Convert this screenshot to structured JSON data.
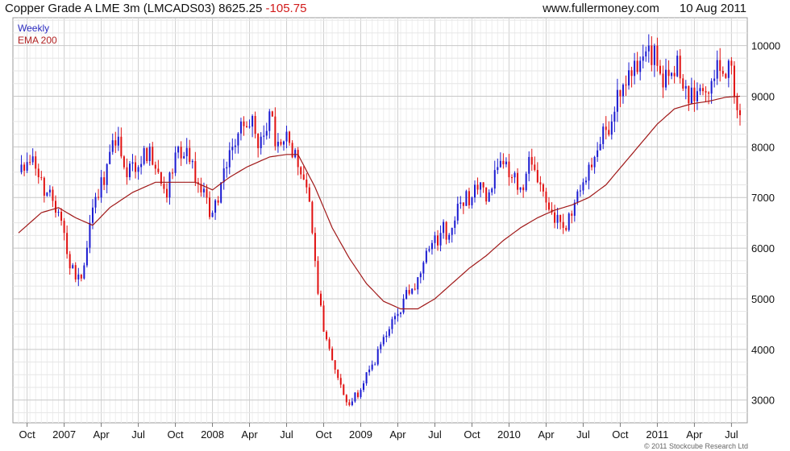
{
  "header": {
    "instrument": "Copper Grade A LME 3m (LMCADS03)",
    "last_price": "8625.25",
    "change": "-105.75",
    "website": "www.fullermoney.com",
    "date": "10 Aug 2011"
  },
  "copyright": "© 2011 Stockcube Research Ltd",
  "chart_data": {
    "type": "candlestick",
    "xlabel": "",
    "ylabel": "",
    "ylim": [
      2550,
      10550
    ],
    "grid": true,
    "legend_placement": "top-left",
    "y_ticks": [
      3000,
      4000,
      5000,
      6000,
      7000,
      8000,
      9000,
      10000
    ],
    "x_ticks": [
      "Oct",
      "2007",
      "Apr",
      "Jul",
      "Oct",
      "2008",
      "Apr",
      "Jul",
      "Oct",
      "2009",
      "Apr",
      "Jul",
      "Oct",
      "2010",
      "Apr",
      "Jul",
      "Oct",
      "2011",
      "Apr",
      "Jul"
    ],
    "x_tick_index": [
      3,
      16,
      29,
      42,
      55,
      68,
      81,
      94,
      107,
      120,
      133,
      146,
      159,
      172,
      185,
      198,
      211,
      224,
      237,
      250
    ],
    "colors": {
      "up": "#1a1ad0",
      "down": "#e01010",
      "ema": "#a01818"
    },
    "series": [
      {
        "name": "Weekly",
        "kind": "weekly_candles",
        "close_anchors": [
          [
            0,
            7500
          ],
          [
            3,
            7700
          ],
          [
            7,
            7400
          ],
          [
            10,
            7100
          ],
          [
            13,
            6700
          ],
          [
            16,
            6300
          ],
          [
            18,
            5600
          ],
          [
            22,
            5400
          ],
          [
            25,
            6500
          ],
          [
            28,
            7000
          ],
          [
            32,
            7900
          ],
          [
            35,
            8200
          ],
          [
            38,
            7400
          ],
          [
            42,
            7600
          ],
          [
            46,
            8000
          ],
          [
            49,
            7500
          ],
          [
            52,
            7000
          ],
          [
            56,
            8000
          ],
          [
            60,
            7700
          ],
          [
            64,
            7100
          ],
          [
            68,
            6700
          ],
          [
            71,
            7300
          ],
          [
            75,
            8000
          ],
          [
            78,
            8500
          ],
          [
            81,
            8400
          ],
          [
            85,
            8200
          ],
          [
            88,
            8700
          ],
          [
            91,
            8100
          ],
          [
            94,
            8300
          ],
          [
            98,
            7600
          ],
          [
            101,
            7200
          ],
          [
            103,
            6300
          ],
          [
            105,
            5100
          ],
          [
            108,
            4200
          ],
          [
            111,
            3600
          ],
          [
            114,
            3100
          ],
          [
            116,
            2900
          ],
          [
            120,
            3200
          ],
          [
            124,
            3700
          ],
          [
            127,
            4100
          ],
          [
            130,
            4400
          ],
          [
            133,
            4700
          ],
          [
            137,
            5100
          ],
          [
            141,
            5500
          ],
          [
            145,
            6100
          ],
          [
            148,
            6300
          ],
          [
            152,
            6400
          ],
          [
            155,
            6900
          ],
          [
            159,
            7000
          ],
          [
            162,
            7300
          ],
          [
            165,
            7100
          ],
          [
            168,
            7600
          ],
          [
            172,
            7400
          ],
          [
            176,
            7200
          ],
          [
            179,
            7800
          ],
          [
            182,
            7300
          ],
          [
            185,
            6900
          ],
          [
            188,
            6500
          ],
          [
            191,
            6400
          ],
          [
            195,
            6900
          ],
          [
            198,
            7300
          ],
          [
            202,
            7800
          ],
          [
            205,
            8400
          ],
          [
            208,
            8500
          ],
          [
            211,
            9000
          ],
          [
            215,
            9400
          ],
          [
            218,
            9700
          ],
          [
            221,
            10000
          ],
          [
            224,
            9600
          ],
          [
            228,
            9400
          ],
          [
            231,
            9800
          ],
          [
            234,
            9200
          ],
          [
            237,
            8900
          ],
          [
            240,
            9100
          ],
          [
            243,
            9300
          ],
          [
            246,
            9500
          ],
          [
            249,
            9700
          ],
          [
            251,
            9000
          ],
          [
            253,
            8625
          ]
        ]
      },
      {
        "name": "EMA 200",
        "kind": "ema",
        "points": [
          [
            0,
            6300
          ],
          [
            8,
            6700
          ],
          [
            14,
            6800
          ],
          [
            20,
            6600
          ],
          [
            26,
            6450
          ],
          [
            32,
            6800
          ],
          [
            40,
            7100
          ],
          [
            48,
            7300
          ],
          [
            56,
            7300
          ],
          [
            62,
            7300
          ],
          [
            68,
            7150
          ],
          [
            74,
            7400
          ],
          [
            80,
            7600
          ],
          [
            88,
            7800
          ],
          [
            94,
            7850
          ],
          [
            98,
            7850
          ],
          [
            104,
            7200
          ],
          [
            110,
            6400
          ],
          [
            116,
            5800
          ],
          [
            122,
            5300
          ],
          [
            128,
            4950
          ],
          [
            134,
            4800
          ],
          [
            140,
            4800
          ],
          [
            146,
            5000
          ],
          [
            152,
            5300
          ],
          [
            158,
            5600
          ],
          [
            164,
            5850
          ],
          [
            170,
            6150
          ],
          [
            176,
            6400
          ],
          [
            182,
            6600
          ],
          [
            188,
            6750
          ],
          [
            194,
            6850
          ],
          [
            200,
            7000
          ],
          [
            206,
            7250
          ],
          [
            212,
            7650
          ],
          [
            218,
            8050
          ],
          [
            224,
            8450
          ],
          [
            230,
            8750
          ],
          [
            236,
            8850
          ],
          [
            242,
            8900
          ],
          [
            248,
            8980
          ],
          [
            253,
            9000
          ]
        ]
      }
    ]
  }
}
